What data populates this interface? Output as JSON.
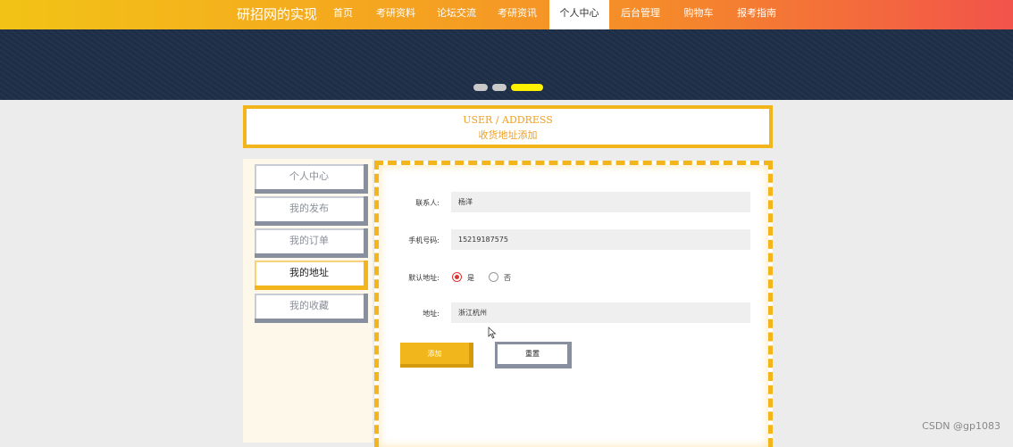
{
  "nav": {
    "brand": "研招网的实现",
    "items": [
      {
        "label": "首页"
      },
      {
        "label": "考研资料"
      },
      {
        "label": "论坛交流"
      },
      {
        "label": "考研资讯"
      },
      {
        "label": "个人中心"
      },
      {
        "label": "后台管理"
      },
      {
        "label": "购物车"
      },
      {
        "label": "报考指南"
      }
    ],
    "active": "个人中心"
  },
  "carousel": {
    "dots": 3,
    "active_dot": 3
  },
  "header": {
    "title_en": "USER / ADDRESS",
    "title_cn": "收货地址添加"
  },
  "sidebar": {
    "items": [
      {
        "label": "个人中心"
      },
      {
        "label": "我的发布"
      },
      {
        "label": "我的订单"
      },
      {
        "label": "我的地址"
      },
      {
        "label": "我的收藏"
      }
    ],
    "active": "我的地址"
  },
  "form": {
    "contact_label": "联系人:",
    "contact_value": "杨洋",
    "phone_label": "手机号码:",
    "phone_value": "15219187575",
    "default_label": "默认地址:",
    "default_yes": "是",
    "default_no": "否",
    "default_selected": "是",
    "address_label": "地址:",
    "address_value": "浙江杭州",
    "add_button": "添加",
    "reset_button": "重置"
  },
  "watermark": "CSDN @gp1083",
  "colors": {
    "accent": "#f2b51b",
    "banner": "#1f2f48",
    "nav_start": "#f2c316",
    "nav_end": "#f2534a"
  }
}
